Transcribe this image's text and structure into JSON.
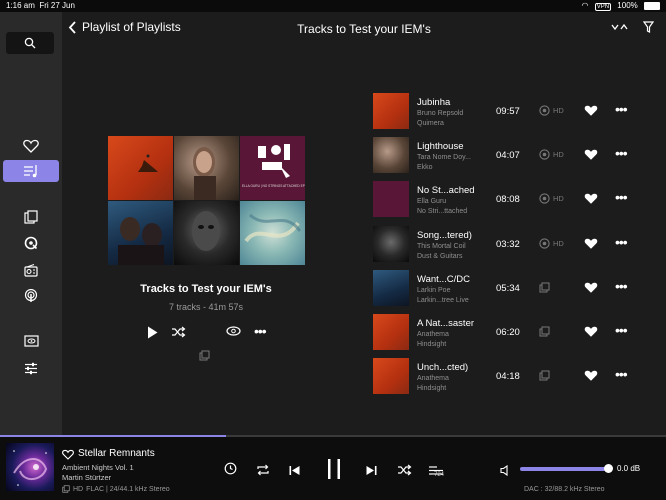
{
  "status_bar": {
    "time": "1:16 am",
    "date": "Fri 27 Jun",
    "vpn": "VPN",
    "battery": "100%"
  },
  "nav": {
    "back_label": "Playlist of Playlists",
    "title": "Tracks to Test your IEM's"
  },
  "playlist": {
    "title": "Tracks to Test your IEM's",
    "meta": "7 tracks - 41m 57s"
  },
  "tracks": [
    {
      "title": "Jubinha",
      "artist": "Bruno Repsold",
      "album": "Quimera",
      "duration": "09:57",
      "hd": "HD"
    },
    {
      "title": "Lighthouse",
      "artist": "Tara Nome Doy...",
      "album": "Ekko",
      "duration": "04:07",
      "hd": "HD"
    },
    {
      "title": "No St...ached",
      "artist": "Ella Guru",
      "album": "No Stri...ttached",
      "duration": "08:08",
      "hd": "HD"
    },
    {
      "title": "Song...tered)",
      "artist": "This Mortal Coil",
      "album": "Dust & Guitars",
      "duration": "03:32",
      "hd": "HD"
    },
    {
      "title": "Want...C/DC",
      "artist": "Larkin Poe",
      "album": "Larkin...tree Live",
      "duration": "05:34",
      "hd": ""
    },
    {
      "title": "A Nat...saster",
      "artist": "Anathema",
      "album": "Hindsight",
      "duration": "06:20",
      "hd": ""
    },
    {
      "title": "Unch...cted)",
      "artist": "Anathema",
      "album": "Hindsight",
      "duration": "04:18",
      "hd": ""
    }
  ],
  "mosaic_label": "ELLA GURU | NO STRINGS ATTACHED EP",
  "now_playing": {
    "title": "Stellar Remnants",
    "album": "Ambient Nights Vol. 1",
    "artist": "Martin Stürtzer",
    "hd": "HD",
    "format": "FLAC | 24/44.1 kHz Stereo",
    "queue_count": "-724",
    "volume_label": "0.0 dB",
    "volume_level": 1.0,
    "progress_fraction": 0.34,
    "dac": "DAC : 32/88.2 kHz Stereo"
  },
  "colors": {
    "accent": "#8c84e6",
    "background": "#1c1c1c",
    "sidebar": "#2a2a2a"
  }
}
